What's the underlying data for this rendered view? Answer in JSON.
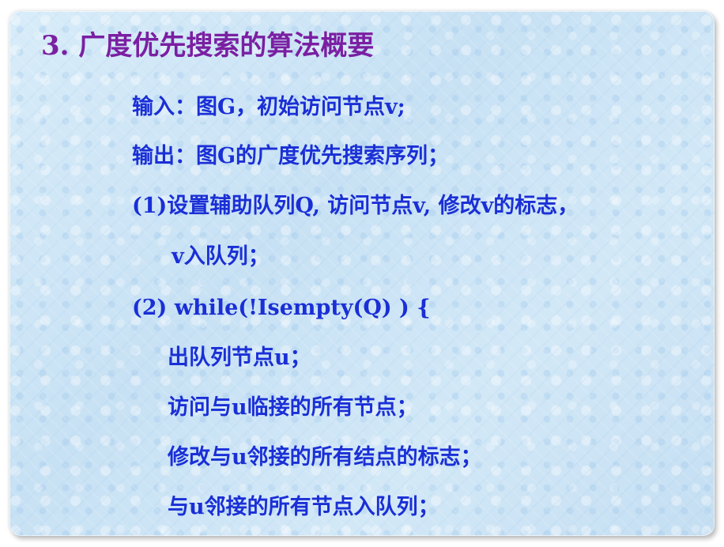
{
  "slide": {
    "title": "3. 广度优先搜索的算法概要",
    "lines": [
      "输入：图G，初始访问节点v;",
      "输出：图G的广度优先搜索序列；",
      "(1)设置辅助队列Q, 访问节点v, 修改v的标志，",
      "v入队列；",
      "(2) while(!Isempty(Q) ) {",
      "出队列节点u；",
      "访问与u临接的所有节点；",
      "修改与u邻接的所有结点的标志；",
      "与u邻接的所有节点入队列；"
    ]
  },
  "colors": {
    "title": "#7a1fa2",
    "body": "#1a2fd6",
    "background": "#cfe6f6"
  }
}
